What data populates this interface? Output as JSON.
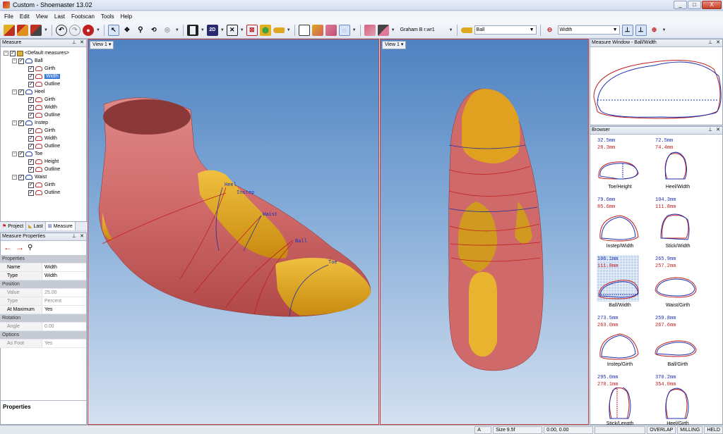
{
  "window": {
    "title": "Custom - Shoemaster 13.02",
    "min": "_",
    "max": "□",
    "close": "X"
  },
  "menu": [
    "File",
    "Edit",
    "View",
    "Last",
    "Footscan",
    "Tools",
    "Help"
  ],
  "toolbar": {
    "twod_label": "2D",
    "foot_label": "Graham B r.wr1",
    "measure_label": "Ball",
    "type_label": "Width"
  },
  "measure_panel": {
    "title": "Measure",
    "root": "<Default measures>",
    "groups": [
      {
        "name": "Ball",
        "items": [
          "Girth",
          "Width",
          "Outline"
        ]
      },
      {
        "name": "Heel",
        "items": [
          "Girth",
          "Width",
          "Outline"
        ]
      },
      {
        "name": "Instep",
        "items": [
          "Girth",
          "Width",
          "Outline"
        ]
      },
      {
        "name": "Toe",
        "items": [
          "Height",
          "Outline"
        ]
      },
      {
        "name": "Waist",
        "items": [
          "Girth",
          "Outline"
        ]
      }
    ],
    "selected": "Width",
    "tabs": [
      "Project",
      "Last",
      "Measure"
    ]
  },
  "props_panel": {
    "title": "Measure Properties",
    "rows": [
      {
        "cat": "Properties"
      },
      {
        "k": "Name",
        "v": "Width"
      },
      {
        "k": "Type",
        "v": "Width"
      },
      {
        "cat": "Position"
      },
      {
        "k": "Value",
        "v": "25.00",
        "dis": true
      },
      {
        "k": "Type",
        "v": "Percent",
        "dis": true
      },
      {
        "k": "At Maximum",
        "v": "Yes"
      },
      {
        "cat": "Rotation"
      },
      {
        "k": "Angle",
        "v": "0.00",
        "dis": true
      },
      {
        "cat": "Options"
      },
      {
        "k": "As Foot",
        "v": "Yes",
        "dis": true
      }
    ],
    "footer": "Properties"
  },
  "view1": {
    "label": "View 1 ▾",
    "annotations": [
      "Heel",
      "Instep",
      "Waist",
      "Ball",
      "Toe"
    ]
  },
  "view2": {
    "label": "View 1 ▾"
  },
  "measure_window": {
    "title": "Measure Window - Ball/Width"
  },
  "browser": {
    "title": "Browser",
    "cells": [
      {
        "v1": "32.5mm",
        "v2": "28.3mm",
        "cap": "Toe/Height"
      },
      {
        "v1": "72.5mm",
        "v2": "74.4mm",
        "cap": "Heel/Width"
      },
      {
        "v1": "79.6mm",
        "v2": "85.6mm",
        "cap": "Instep/Width"
      },
      {
        "v1": "104.3mm",
        "v2": "111.8mm",
        "cap": "Stick/Width"
      },
      {
        "v1": "106.1mm",
        "v2": "111.8mm",
        "cap": "Ball/Width"
      },
      {
        "v1": "265.9mm",
        "v2": "257.2mm",
        "cap": "Waist/Girth"
      },
      {
        "v1": "273.5mm",
        "v2": "263.0mm",
        "cap": "Instep/Girth"
      },
      {
        "v1": "259.8mm",
        "v2": "267.6mm",
        "cap": "Ball/Girth"
      },
      {
        "v1": "295.0mm",
        "v2": "270.1mm",
        "cap": "Stick/Length"
      },
      {
        "v1": "370.2mm",
        "v2": "354.0mm",
        "cap": "Heel/Girth"
      }
    ]
  },
  "status": {
    "ab": "A",
    "size": "Size 9.5f",
    "coords": "0.00, 0.00",
    "flags": [
      "OVERLAP",
      "MILLING",
      "HELD"
    ]
  }
}
